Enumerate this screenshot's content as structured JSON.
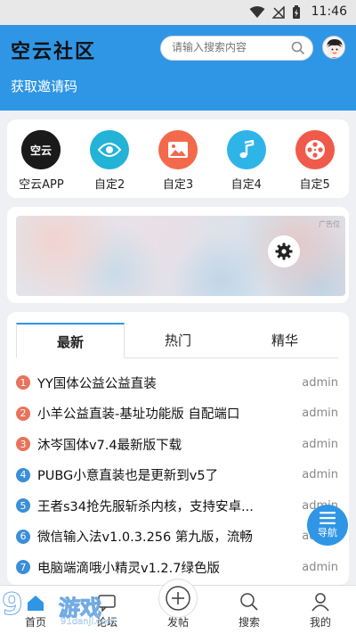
{
  "status_bar": {
    "time": "11:46"
  },
  "header": {
    "logo_text": "空云社区",
    "search_placeholder": "请输入搜索内容",
    "invite_link": "获取邀请码",
    "bg_color": "#2f96e6"
  },
  "quick_links": [
    {
      "label": "空云APP",
      "icon": "app-logo-icon",
      "color": "#1a1a1a"
    },
    {
      "label": "自定2",
      "icon": "eye-icon",
      "color": "#22b3d6"
    },
    {
      "label": "自定3",
      "icon": "image-icon",
      "color": "#f2694b"
    },
    {
      "label": "自定4",
      "icon": "music-note-icon",
      "color": "#2fb4e8"
    },
    {
      "label": "自定5",
      "icon": "film-reel-icon",
      "color": "#f05a4a"
    }
  ],
  "banner": {
    "ad_tag": "广告位"
  },
  "feed": {
    "tabs": [
      {
        "label": "最新",
        "active": true
      },
      {
        "label": "热门",
        "active": false
      },
      {
        "label": "精华",
        "active": false
      }
    ],
    "items": [
      {
        "num": "1",
        "title": "YY国体公益公益直装",
        "author": "admin",
        "color": "#e8735a"
      },
      {
        "num": "2",
        "title": "小羊公益直装-基址功能版 自配端口",
        "author": "admin",
        "color": "#e8735a"
      },
      {
        "num": "3",
        "title": "沐岑国体v7.4最新版下载",
        "author": "admin",
        "color": "#e8735a"
      },
      {
        "num": "4",
        "title": "PUBG小意直装也是更新到v5了",
        "author": "admin",
        "color": "#3a8fd8"
      },
      {
        "num": "5",
        "title": "王者s34抢先服斩杀内核，支持安卓...",
        "author": "admin",
        "color": "#3a8fd8"
      },
      {
        "num": "6",
        "title": "微信输入法v1.0.3.256 第九版，流畅",
        "author": "admin",
        "color": "#3a8fd8"
      },
      {
        "num": "7",
        "title": "电脑端滴哦小精灵v1.2.7绿色版",
        "author": "admin",
        "color": "#3a8fd8"
      }
    ]
  },
  "fab": {
    "label": "导航"
  },
  "tabbar": {
    "items": [
      {
        "label": "首页",
        "icon": "home-icon"
      },
      {
        "label": "论坛",
        "icon": "forum-icon"
      },
      {
        "label": "发帖",
        "icon": "plus-circle-icon"
      },
      {
        "label": "搜索",
        "icon": "search-icon"
      },
      {
        "label": "我的",
        "icon": "user-icon"
      }
    ]
  },
  "watermark": {
    "big": "9",
    "text": "游戏",
    "url": "91danji.com"
  }
}
